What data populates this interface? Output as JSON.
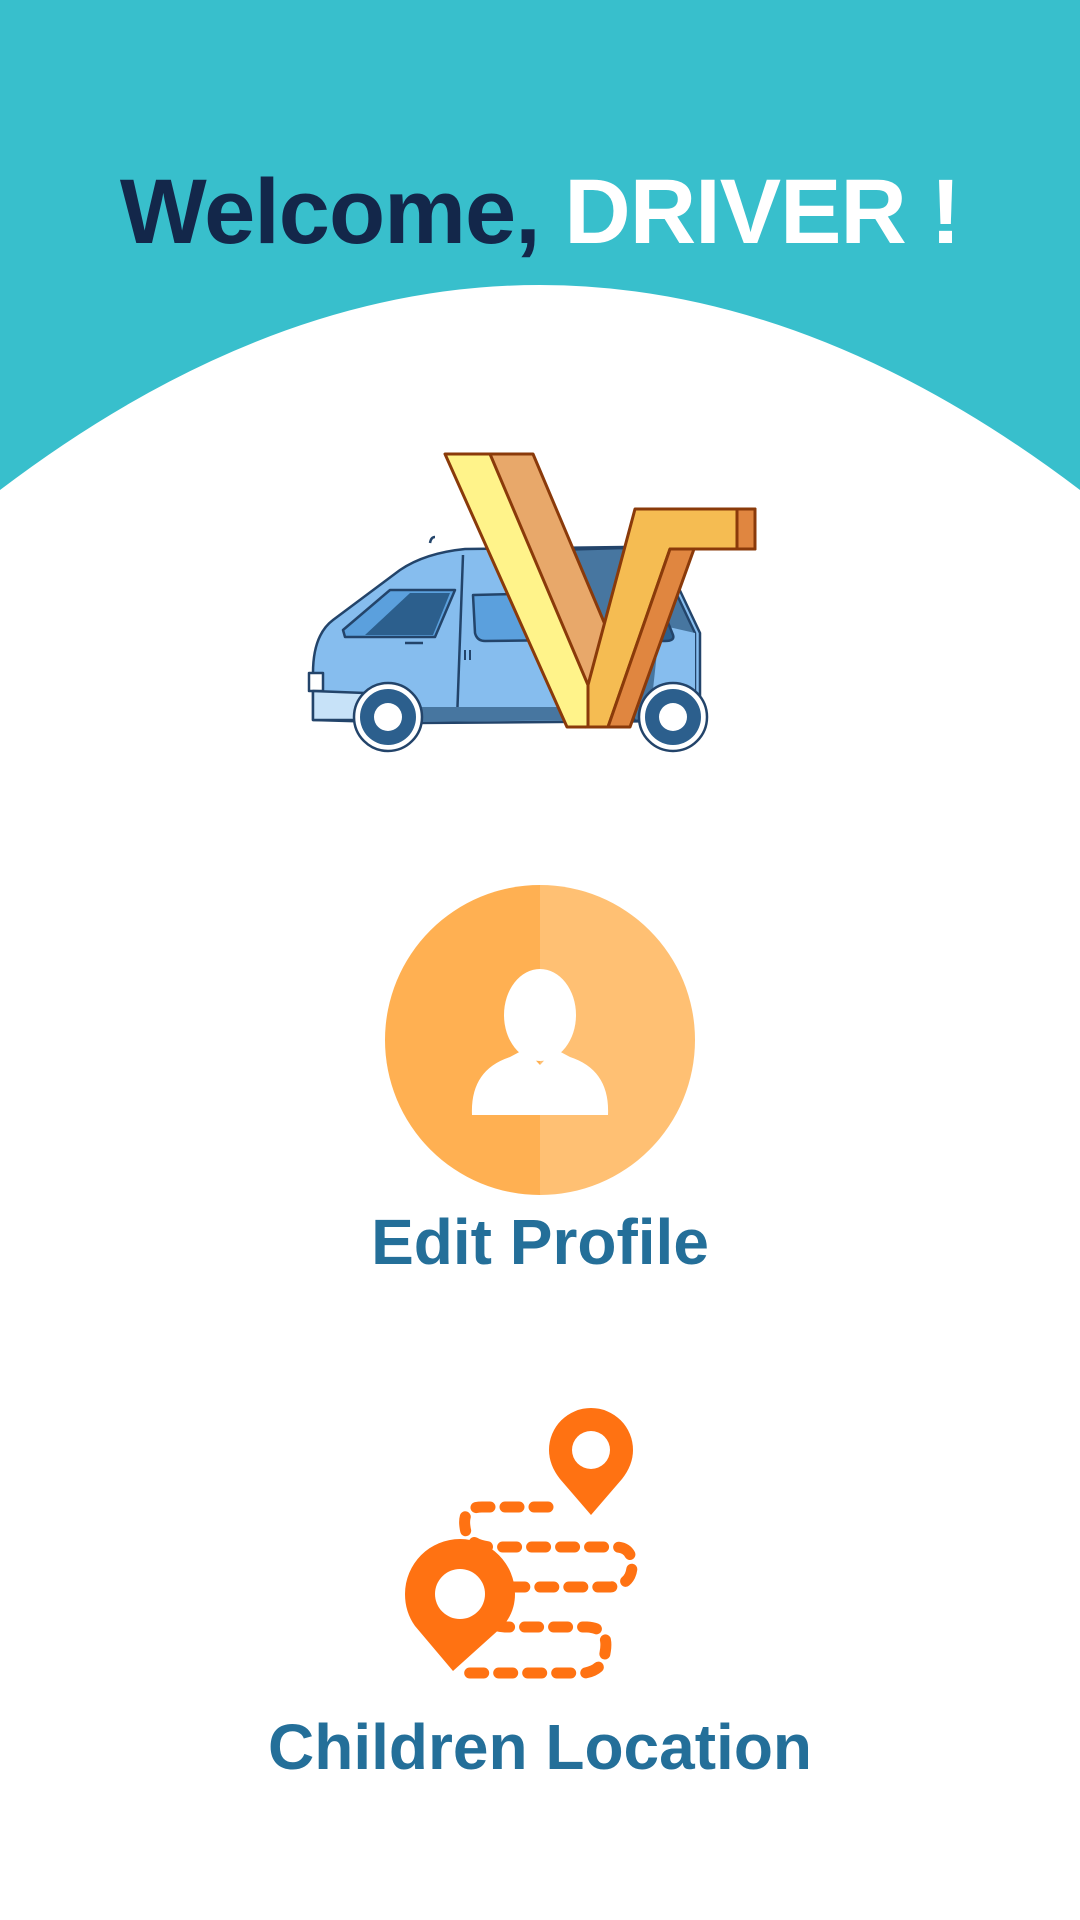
{
  "header": {
    "greeting": "Welcome,",
    "role": "DRIVER !"
  },
  "logo": {
    "icon": "van-v-logo-icon"
  },
  "menu": [
    {
      "label": "Edit Profile",
      "icon": "user-avatar-icon"
    },
    {
      "label": "Children Location",
      "icon": "map-route-icon"
    }
  ],
  "colors": {
    "header_bg": "#38bfcc",
    "greeting_text": "#13274a",
    "role_text": "#ffffff",
    "label_text": "#246f99",
    "avatar_left": "#ffb052",
    "avatar_right": "#ffc073",
    "pin_orange": "#ff7212"
  }
}
